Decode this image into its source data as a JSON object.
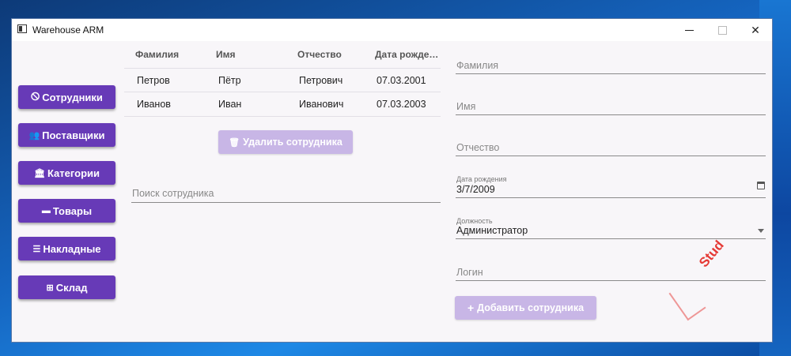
{
  "window": {
    "title": "Warehouse ARM"
  },
  "nav": [
    {
      "icon": "🛇",
      "label": "Сотрудники"
    },
    {
      "icon": "👥",
      "label": "Поставщики"
    },
    {
      "icon": "🏛",
      "label": "Категории"
    },
    {
      "icon": "▬",
      "label": "Товары"
    },
    {
      "icon": "☰",
      "label": "Накладные"
    },
    {
      "icon": "⊞",
      "label": "Склад"
    }
  ],
  "table": {
    "headers": [
      "Фамилия",
      "Имя",
      "Отчество",
      "Дата рожде…"
    ],
    "rows": [
      [
        "Петров",
        "Пётр",
        "Петрович",
        "07.03.2001"
      ],
      [
        "Иванов",
        "Иван",
        "Иванович",
        "07.03.2003"
      ]
    ]
  },
  "delete_button": {
    "icon": "🗑",
    "label": "Удалить сотрудника"
  },
  "search": {
    "placeholder": "Поиск сотрудника"
  },
  "form": {
    "lastname_placeholder": "Фамилия",
    "firstname_placeholder": "Имя",
    "patronymic_placeholder": "Отчество",
    "birthdate_label": "Дата рождения",
    "birthdate_value": "3/7/2009",
    "position_label": "Должность",
    "position_value": "Администратор",
    "login_placeholder": "Логин"
  },
  "add_button": {
    "icon": "+",
    "label": "Добавить сотрудника"
  },
  "watermark": "Stud",
  "colors": {
    "accent": "#673ab7",
    "accent_disabled": "#c8b6e6",
    "watermark": "#e53935"
  }
}
